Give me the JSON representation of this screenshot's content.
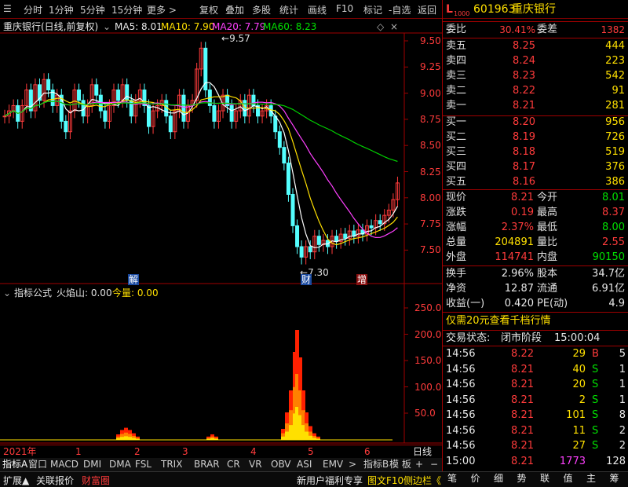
{
  "toolbar": {
    "period_tabs": [
      "分时",
      "1分钟",
      "5分钟",
      "15分钟",
      "更多 >"
    ],
    "tools": [
      "复权",
      "叠加",
      "多股",
      "统计",
      "画线",
      "F10",
      "标记",
      "-自选",
      "返回"
    ]
  },
  "chart_header": {
    "stock": "重庆银行(日线,前复权)",
    "ma5": "MA5: 8.01",
    "ma10": "MA10: 7.90",
    "ma20": "MA20: 7.79",
    "ma60": "MA60: 8.23",
    "high_marker": "9.57",
    "low_marker": "7.30"
  },
  "price_axis": [
    "9.50",
    "9.25",
    "9.00",
    "8.75",
    "8.50",
    "8.25",
    "8.00",
    "7.75",
    "7.50"
  ],
  "event_tags": [
    "解",
    "财",
    "增"
  ],
  "indicator_header": {
    "name": "指标公式",
    "label": "火焰山: 0.00",
    "volume": "今量: 0.00"
  },
  "indicator_axis": [
    "250.0",
    "200.0",
    "150.0",
    "100.0",
    "50.0"
  ],
  "time_axis": [
    "2021年",
    "1",
    "2",
    "3",
    "4",
    "5",
    "6"
  ],
  "time_axis_right": "日线",
  "indicator_tabs": [
    "指标A",
    "窗口",
    "MACD",
    "DMI",
    "DMA",
    "FSL",
    "TRIX",
    "BRAR",
    "CR",
    "VR",
    "OBV",
    "ASI",
    "EMV",
    ">",
    "指标B",
    "模 板",
    "+",
    "−"
  ],
  "bottom_tabs": [
    "扩展▲",
    "关联报价",
    "财富圈"
  ],
  "bottom_right": {
    "promo": "新用户福利专享",
    "f10": "图文F10",
    "side": "侧边栏《"
  },
  "quote": {
    "badge_l": "L",
    "badge_sub": "1000",
    "code": "601963",
    "name": "重庆银行",
    "weibi_label": "委比",
    "weibi": "30.41%",
    "weicha_label": "委差",
    "weicha": "1382",
    "asks": [
      {
        "label": "卖五",
        "price": "8.25",
        "vol": "444"
      },
      {
        "label": "卖四",
        "price": "8.24",
        "vol": "223"
      },
      {
        "label": "卖三",
        "price": "8.23",
        "vol": "542"
      },
      {
        "label": "卖二",
        "price": "8.22",
        "vol": "91"
      },
      {
        "label": "卖一",
        "price": "8.21",
        "vol": "281"
      }
    ],
    "bids": [
      {
        "label": "买一",
        "price": "8.20",
        "vol": "956"
      },
      {
        "label": "买二",
        "price": "8.19",
        "vol": "726"
      },
      {
        "label": "买三",
        "price": "8.18",
        "vol": "519"
      },
      {
        "label": "买四",
        "price": "8.17",
        "vol": "376"
      },
      {
        "label": "买五",
        "price": "8.16",
        "vol": "386"
      }
    ],
    "stats": [
      {
        "l1": "现价",
        "v1": "8.21",
        "c1": "red",
        "l2": "今开",
        "v2": "8.01",
        "c2": "green"
      },
      {
        "l1": "涨跌",
        "v1": "0.19",
        "c1": "red",
        "l2": "最高",
        "v2": "8.37",
        "c2": "red"
      },
      {
        "l1": "涨幅",
        "v1": "2.37%",
        "c1": "red",
        "l2": "最低",
        "v2": "8.00",
        "c2": "green"
      },
      {
        "l1": "总量",
        "v1": "204891",
        "c1": "yellow",
        "l2": "量比",
        "v2": "2.55",
        "c2": "red"
      },
      {
        "l1": "外盘",
        "v1": "114741",
        "c1": "red",
        "l2": "内盘",
        "v2": "90150",
        "c2": "green"
      }
    ],
    "fin": [
      {
        "l1": "换手",
        "v1": "2.96%",
        "l2": "股本",
        "v2": "34.7亿"
      },
      {
        "l1": "净资",
        "v1": "12.87",
        "l2": "流通",
        "v2": "6.91亿"
      },
      {
        "l1": "收益(一)",
        "v1": "0.420",
        "l2": "PE(动)",
        "v2": "4.9"
      }
    ],
    "promo": "仅需20元查看千档行情",
    "status_label": "交易状态:",
    "status": "闭市阶段",
    "status_time": "15:00:04",
    "trades": [
      {
        "time": "14:56",
        "price": "8.22",
        "vol": "29",
        "dir": "B",
        "n": "5"
      },
      {
        "time": "14:56",
        "price": "8.21",
        "vol": "40",
        "dir": "S",
        "n": "1"
      },
      {
        "time": "14:56",
        "price": "8.21",
        "vol": "20",
        "dir": "S",
        "n": "1"
      },
      {
        "time": "14:56",
        "price": "8.21",
        "vol": "2",
        "dir": "S",
        "n": "1"
      },
      {
        "time": "14:56",
        "price": "8.21",
        "vol": "101",
        "dir": "S",
        "n": "8"
      },
      {
        "time": "14:56",
        "price": "8.21",
        "vol": "11",
        "dir": "S",
        "n": "2"
      },
      {
        "time": "14:56",
        "price": "8.21",
        "vol": "27",
        "dir": "S",
        "n": "2"
      },
      {
        "time": "15:00",
        "price": "8.21",
        "vol": "1773",
        "dir": "",
        "n": "128"
      }
    ],
    "bottom_tabs": [
      "笔",
      "价",
      "细",
      "势",
      "联",
      "值",
      "主",
      "筹"
    ]
  },
  "colors": {
    "up": "#ff3b3b",
    "down": "#00e000",
    "bg": "#000000",
    "grid": "#7a0000",
    "yellow": "#ffe000",
    "magenta": "#ff40ff"
  }
}
